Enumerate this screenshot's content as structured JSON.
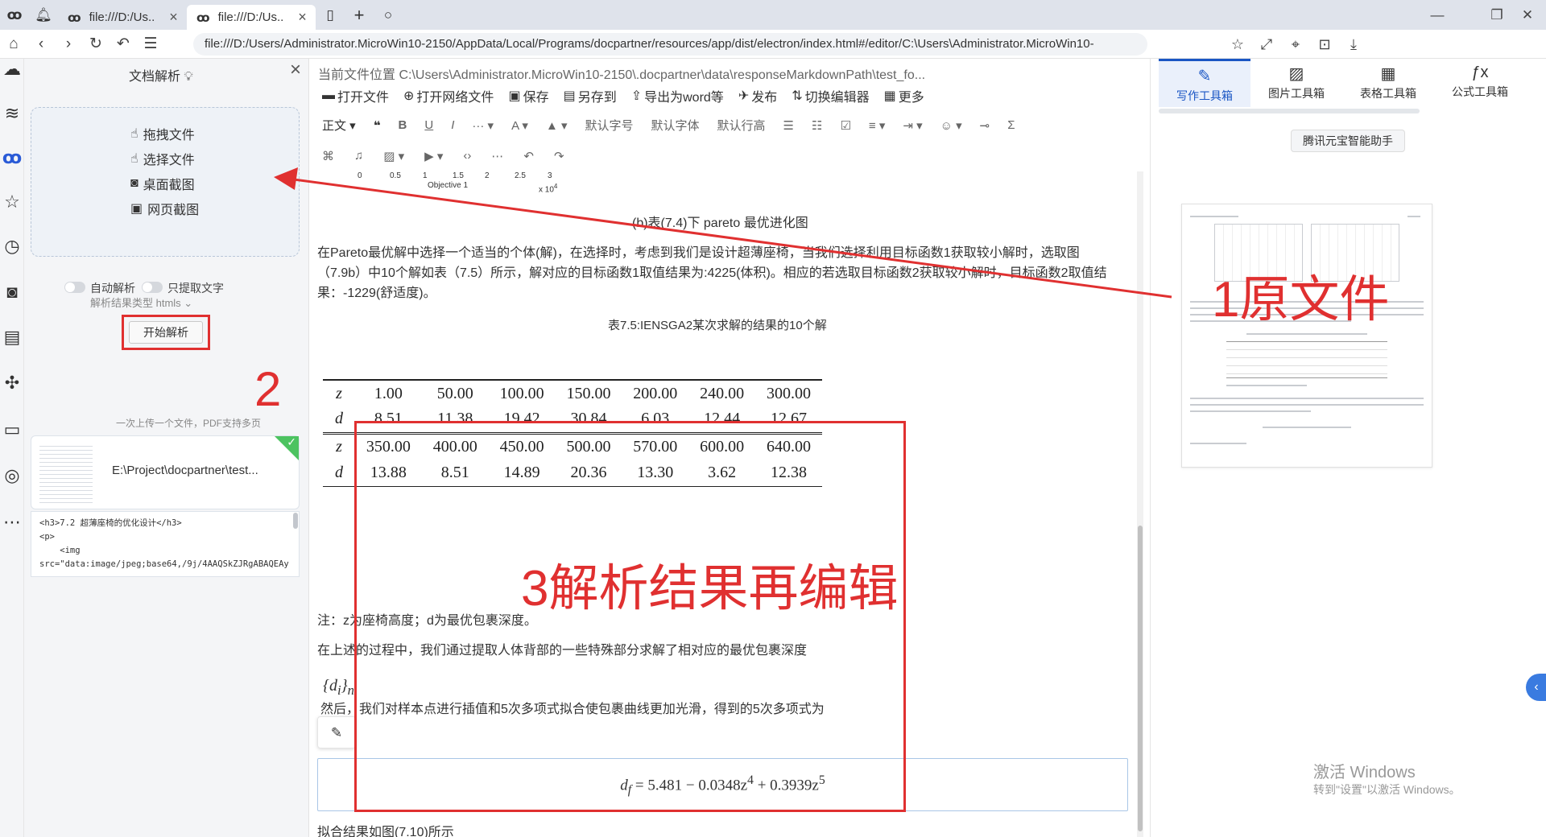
{
  "browser": {
    "tabs": [
      {
        "label": "file:///D:/Us.."
      },
      {
        "label": "file:///D:/Us.."
      }
    ],
    "url": "file:///D:/Users/Administrator.MicroWin10-2150/AppData/Local/Programs/docpartner/resources/app/dist/electron/index.html#/editor/C:\\Users\\Administrator.MicroWin10-"
  },
  "panel": {
    "title": "文档解析",
    "options": [
      "拖拽文件",
      "选择文件",
      "桌面截图",
      "网页截图"
    ],
    "auto_parse": "自动解析",
    "text_only": "只提取文字",
    "result_type": "解析结果类型 htmls",
    "start": "开始解析",
    "annot2": "2",
    "hint": "一次上传一个文件，PDF支持多页",
    "file_path": "E:\\Project\\docpartner\\test...",
    "code": "<h3>7.2 超薄座椅的优化设计</h3>\n<p>\n    <img\nsrc=\"data:image/jpeg;base64,/9j/4AAQSkZJRgABAQEAy"
  },
  "editor": {
    "path": "当前文件位置 C:\\Users\\Administrator.MicroWin10-2150\\.docpartner\\data\\responseMarkdownPath\\test_fo...",
    "toolbar1": [
      "打开文件",
      "打开网络文件",
      "保存",
      "另存到",
      "导出为word等",
      "发布",
      "切换编辑器",
      "更多"
    ],
    "toolbar2": [
      "正文",
      "默认字号",
      "默认字体",
      "默认行高"
    ],
    "fig_ticks": [
      "0",
      "0.5",
      "1",
      "1.5",
      "2",
      "2.5",
      "3"
    ],
    "fig_xlabel": "Objective 1",
    "fig_scale": "x 10",
    "fig_scale_exp": "4",
    "caption": "(b)表(7.4)下 pareto 最优进化图",
    "para1": "在Pareto最优解中选择一个适当的个体(解)，在选择时，考虑到我们是设计超薄座椅，当我们选择利用目标函数1获取较小解时，选取图（7.9b）中10个解如表（7.5）所示，解对应的目标函数1取值结果为:4225(体积)。相应的若选取目标函数2获取较小解时，目标函数2取值结果：-1229(舒适度)。",
    "table_title": "表7.5:IENSGA2某次求解的结果的10个解",
    "table": [
      [
        "z",
        "1.00",
        "50.00",
        "100.00",
        "150.00",
        "200.00",
        "240.00",
        "300.00"
      ],
      [
        "d",
        "8.51",
        "11.38",
        "19.42",
        "30.84",
        "6.03",
        "12.44",
        "12.67"
      ],
      [
        "z",
        "350.00",
        "400.00",
        "450.00",
        "500.00",
        "570.00",
        "600.00",
        "640.00"
      ],
      [
        "d",
        "13.88",
        "8.51",
        "14.89",
        "20.36",
        "13.30",
        "3.62",
        "12.38"
      ]
    ],
    "note": "注：z为座椅高度；d为最优包裹深度。",
    "para2": "在上述的过程中，我们通过提取人体背部的一些特殊部分求解了相对应的最优包裹深度",
    "di": "{d",
    "di_sub1": "i",
    "di_close": "}",
    "di_sub2": "n",
    "para3": "然后，我们对样本点进行插值和5次多项式拟合使包裹曲线更加光滑，得到的5次多项式为",
    "formula": "d",
    "formula_sub": "f",
    "formula_mid": " = 5.481 − 0.0348z",
    "formula_exp1": "4",
    "formula_end": " + 0.3939z",
    "formula_exp2": "5",
    "para4": "拟合结果如图(7.10)所示",
    "annot3": "3解析结果再编辑"
  },
  "right": {
    "tabs": [
      "写作工具箱",
      "图片工具箱",
      "表格工具箱",
      "公式工具箱"
    ],
    "ai": "腾讯元宝智能助手",
    "annot1": "1原文件",
    "activate1": "激活 Windows",
    "activate2": "转到\"设置\"以激活 Windows。"
  },
  "colors": {
    "accent": "#1a56c4",
    "annotation": "#e03030"
  }
}
